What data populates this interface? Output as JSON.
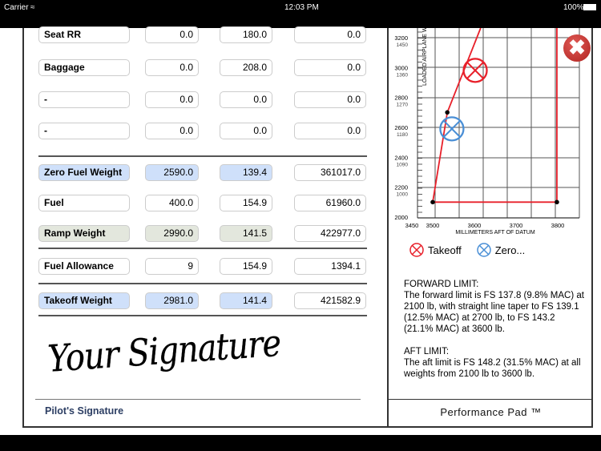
{
  "status_bar": {
    "carrier": "Carrier",
    "time": "12:03 PM",
    "battery": "100%"
  },
  "rows": [
    {
      "name": "Seat RR",
      "weight": "0.0",
      "arm": "180.0",
      "moment": "0.0",
      "style": "plain"
    },
    {
      "name": "Baggage",
      "weight": "0.0",
      "arm": "208.0",
      "moment": "0.0",
      "style": "plain"
    },
    {
      "name": "-",
      "weight": "0.0",
      "arm": "0.0",
      "moment": "0.0",
      "style": "plain"
    },
    {
      "name": "-",
      "weight": "0.0",
      "arm": "0.0",
      "moment": "0.0",
      "style": "plain"
    },
    {
      "name": "Zero Fuel Weight",
      "weight": "2590.0",
      "arm": "139.4",
      "moment": "361017.0",
      "style": "blue"
    },
    {
      "name": "Fuel",
      "weight": "400.0",
      "arm": "154.9",
      "moment": "61960.0",
      "style": "plain"
    },
    {
      "name": "Ramp Weight",
      "weight": "2990.0",
      "arm": "141.5",
      "moment": "422977.0",
      "style": "green"
    },
    {
      "name": "Fuel Allowance",
      "weight": "9",
      "arm": "154.9",
      "moment": "1394.1",
      "style": "plain"
    },
    {
      "name": "Takeoff Weight",
      "weight": "2981.0",
      "arm": "141.4",
      "moment": "421582.9",
      "style": "blue"
    }
  ],
  "signature": {
    "label": "Pilot's Signature",
    "handwriting": "Your Signature"
  },
  "chart_data": {
    "type": "scatter",
    "xlabel": "MILLIMETERS AFT OF DATUM",
    "ylabel": "LOADED AIRPLANE W",
    "x_ticks": [
      "3450",
      "3500",
      "3600",
      "3700",
      "3800"
    ],
    "y_ticks": [
      [
        "3200",
        "1450"
      ],
      [
        "3000",
        "1360"
      ],
      [
        "2800",
        "1270"
      ],
      [
        "2600",
        "1180"
      ],
      [
        "2400",
        "1090"
      ],
      [
        "2200",
        "1000"
      ],
      [
        "2000",
        ""
      ]
    ],
    "xlim": [
      3450,
      3800
    ],
    "ylim": [
      2000,
      3200
    ],
    "envelope": [
      [
        3615,
        3264
      ],
      [
        3535,
        2700
      ],
      [
        3500,
        2100
      ],
      [
        3798,
        2100
      ],
      [
        3798,
        3264
      ]
    ],
    "points": [
      {
        "name": "Takeoff",
        "x": 3602,
        "y": 2981,
        "color": "#e8202a"
      },
      {
        "name": "Zero...",
        "x": 3546,
        "y": 2590,
        "color": "#4a8fd6"
      }
    ],
    "legend": "bottom"
  },
  "legend": {
    "takeoff": "Takeoff",
    "zero": "Zero..."
  },
  "limits": {
    "forward_title": "FORWARD LIMIT:",
    "forward_text": "The forward limit is FS 137.8 (9.8% MAC) at 2100 lb, with straight line taper to FS 139.1 (12.5% MAC) at 2700 lb, to FS 143.2 (21.1% MAC) at 3600 lb.",
    "aft_title": "AFT LIMIT:",
    "aft_text": "The aft limit is FS 148.2 (31.5% MAC) at all weights from 2100 lb to 3600 lb."
  },
  "brand": "Performance Pad ™",
  "colors": {
    "envelope": "#e8202a",
    "close": "#c0302e",
    "header_blue": "#cfe0fa",
    "ramp_green": "#e3e7dd",
    "signature_label": "#2c3e63"
  }
}
